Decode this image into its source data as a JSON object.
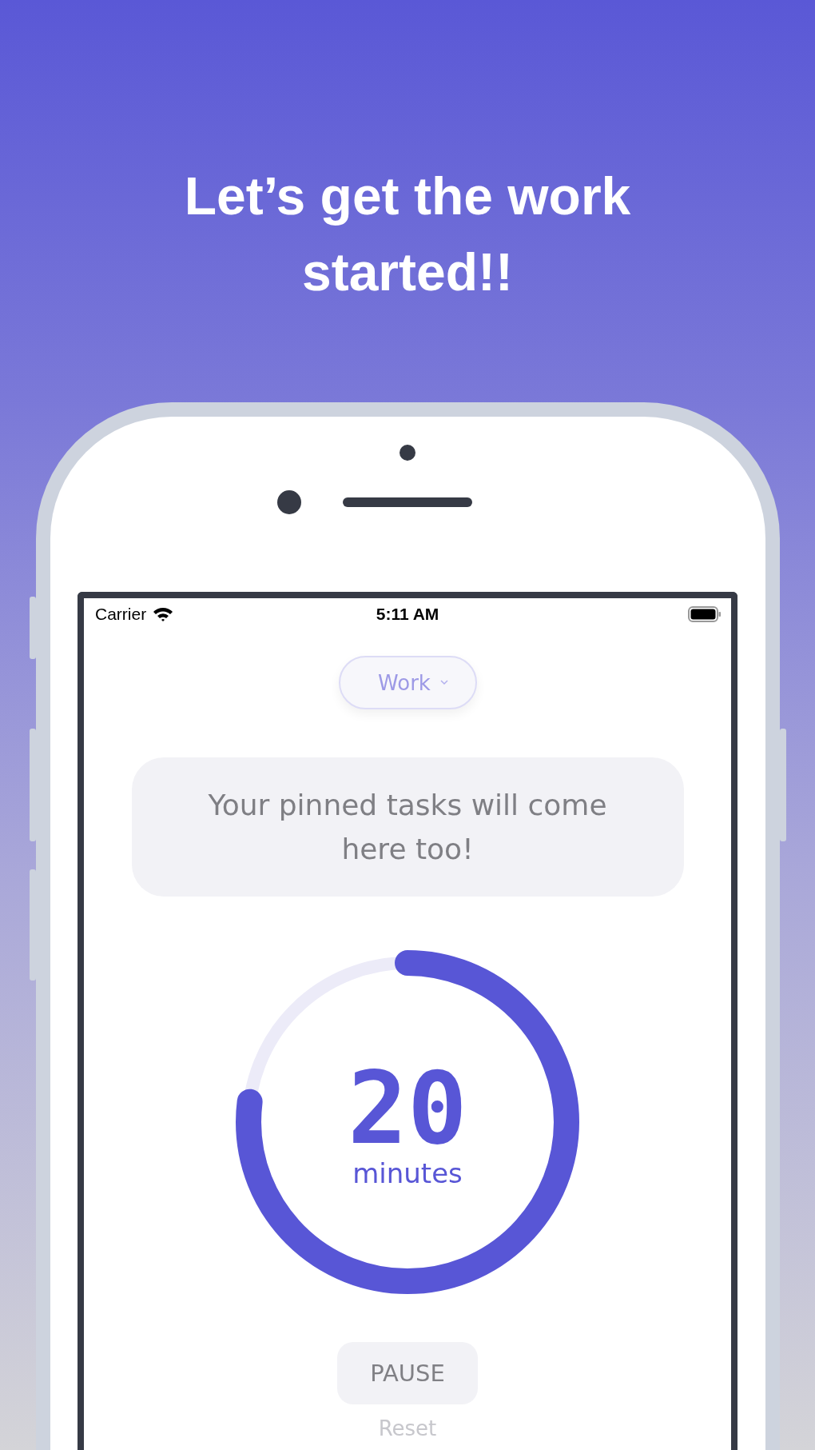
{
  "headline": "Let’s get the work started!!",
  "status_bar": {
    "carrier": "Carrier",
    "time": "5:11 AM"
  },
  "mode_selector": {
    "label": "Work"
  },
  "pinned_message": "Your pinned tasks will come here too!",
  "timer": {
    "value": "20",
    "unit": "minutes",
    "level": 0.77
  },
  "buttons": [
    {
      "kind": "filled",
      "label": "PAUSE"
    },
    {
      "kind": "text",
      "label": "Reset"
    }
  ]
}
